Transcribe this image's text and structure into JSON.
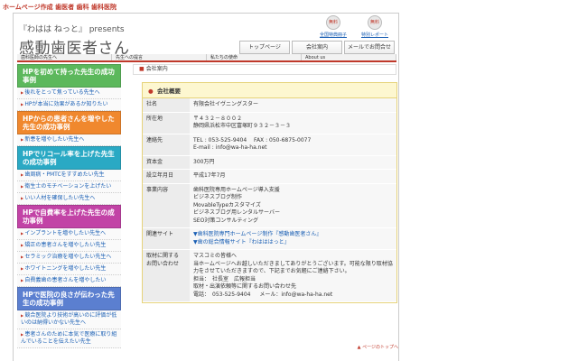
{
  "top_banner": "ホームページ作成 歯医者 歯科 歯科医院",
  "brand": {
    "small": "『わはは ねっと』 presents",
    "title": "感動歯医者さん"
  },
  "head_icons": [
    {
      "badge": "無料",
      "label": "全国特典冊子"
    },
    {
      "badge": "無料",
      "label": "特別レポート"
    }
  ],
  "top_nav": [
    "トップページ",
    "会社案内",
    "メールでお問合せ"
  ],
  "sub_nav": [
    "歯科医師の先生へ",
    "先生への提言",
    "私たちの使命",
    "About us"
  ],
  "sidebar": [
    {
      "title": "HPを初めて持った先生の成功事例",
      "color": "#5cb85c",
      "items": [
        "後れをとって焦っている先生へ",
        "HPが本当に効果があるか知りたい"
      ]
    },
    {
      "title": "HPからの患者さんを増やした先生の成功事例",
      "color": "#f0882e",
      "items": [
        "新患を増やしたい先生へ"
      ]
    },
    {
      "title": "HPでリコール率を上げた先生の成功事例",
      "color": "#2aa9c4",
      "items": [
        "歯周病・PMTCをすすめたい先生",
        "衛生士のモチベーションを上げたい",
        "いい人材を確保したい先生へ"
      ]
    },
    {
      "title": "HPで自費率を上げた先生の成功事例",
      "color": "#c243a6",
      "items": [
        "インプラントを増やしたい先生へ",
        "矯正の患者さんを増やしたい先生",
        "セラミック治療を増やしたい先生へ",
        "ホワイトニングを増やしたい先生",
        "自費義歯の患者さんを増やしたい"
      ]
    },
    {
      "title": "HPで医院の良さが伝わった先生の成功事例",
      "color": "#5b7fd0",
      "items": [
        "競合医院より技術が高いのに評価が低いのは納得いかない先生へ",
        "患者さんのために本気で医療に取り組んでいることを伝えたい先生"
      ]
    }
  ],
  "breadcrumb": "会社案内",
  "card_title": "会社概要",
  "company": [
    {
      "key": "社名",
      "lines": [
        "有限会社イヴニングスター"
      ]
    },
    {
      "key": "所在地",
      "lines": [
        "〒４３２－８００２",
        "静岡県浜松市中区富塚町９３２－３－３"
      ]
    },
    {
      "key": "連絡先",
      "lines": [
        "TEL : 053-525-9404 　FAX : 050-6875-0077",
        "E-mail : info@wa-ha-ha.net"
      ]
    },
    {
      "key": "資本金",
      "lines": [
        "300万円"
      ]
    },
    {
      "key": "設立年月日",
      "lines": [
        "平成17年7月"
      ]
    },
    {
      "key": "事業内容",
      "lines": [
        "歯科医院専用ホームページ導入支援",
        "ビジネスブログ制作",
        "MovableTypeカスタマイズ",
        "ビジネスブログ用レンタルサーバー",
        "SEO対策コンサルティング"
      ]
    },
    {
      "key": "関連サイト",
      "lines": [
        "▼歯科医院専門ホームページ制作『感動歯医者さん』",
        "▼歯の総合情報サイト『わはははっと』"
      ],
      "links": true
    },
    {
      "key": "取材に関する\nお問い合わせ",
      "lines": [
        "マスコミの皆様へ",
        "当ホームページへお越しいただきましてありがとうございます。可能な限り取材協",
        "力をさせていただきますので、下記までお気軽にご連絡下さい。",
        "担当：　社長室　広報担当",
        "取材・出演依頼等に関するお問い合わせ先",
        "電話：　053-525-9404 　 メール：info@wa-ha-ha.net"
      ]
    }
  ],
  "page_top": "ページのトップへ"
}
